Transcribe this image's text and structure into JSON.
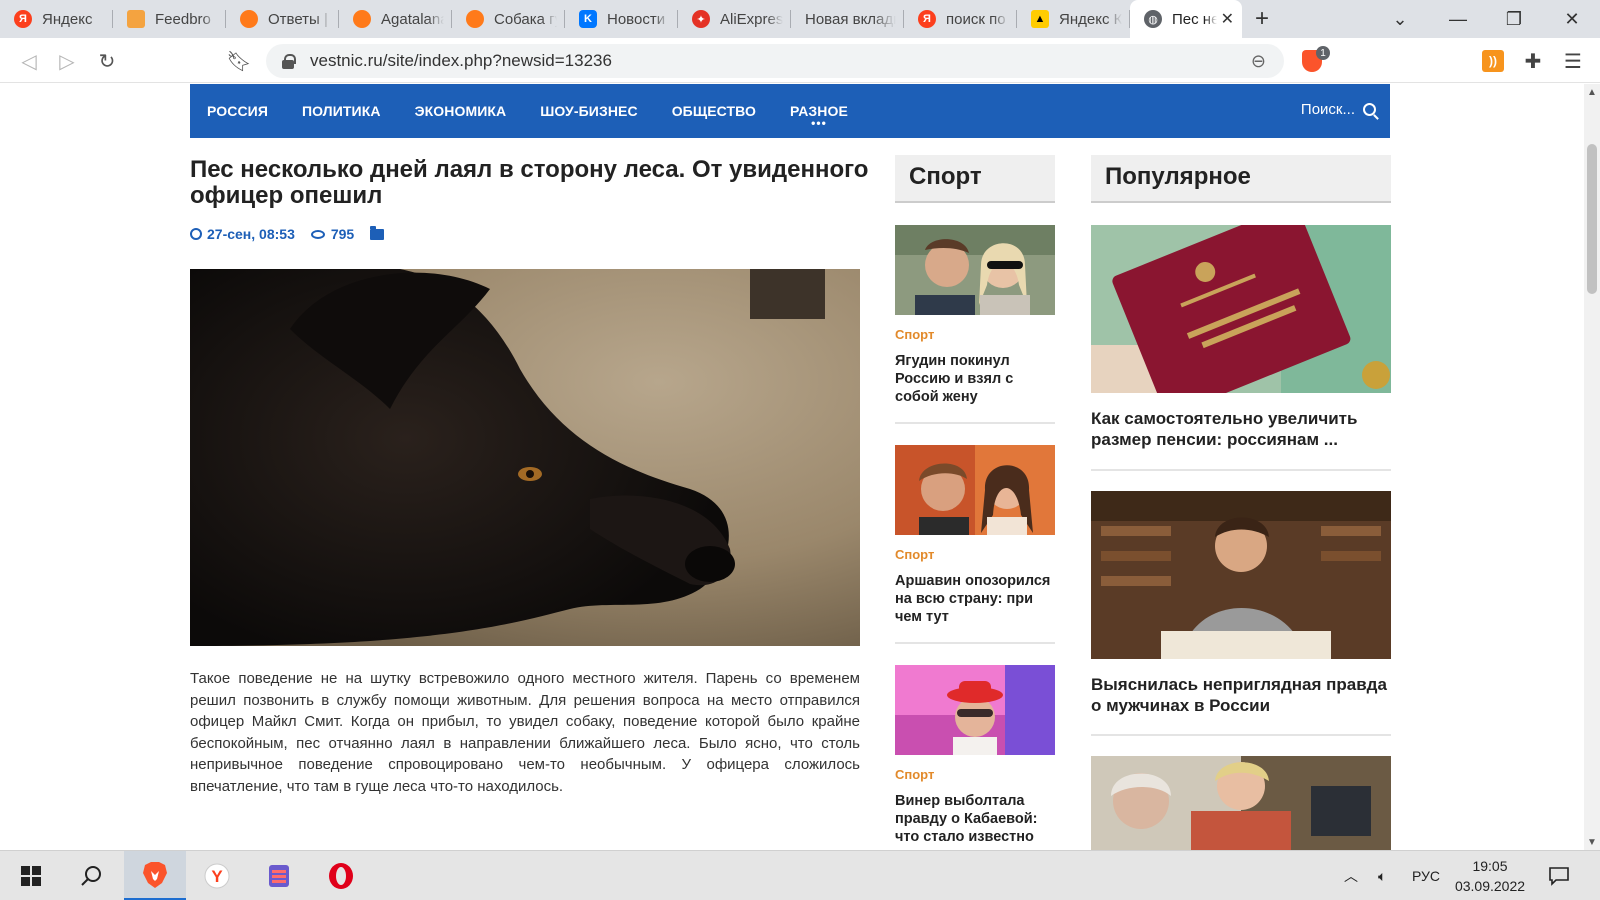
{
  "browser": {
    "tabs": [
      {
        "title": "Яндекс",
        "icon": "yandex-icon"
      },
      {
        "title": "Feedbro",
        "icon": "feedbro-icon"
      },
      {
        "title": "Ответы | Г",
        "icon": "fox-icon"
      },
      {
        "title": "Agatalana",
        "icon": "fox-icon"
      },
      {
        "title": "Собака гу",
        "icon": "fox-icon"
      },
      {
        "title": "Новости",
        "icon": "vk-icon"
      },
      {
        "title": "AliExpress",
        "icon": "aliexpress-icon"
      },
      {
        "title": "Новая вкладк",
        "icon": ""
      },
      {
        "title": "поиск по",
        "icon": "yandex-icon"
      },
      {
        "title": "Яндекс Ка",
        "icon": "yandex-kartinki-icon"
      },
      {
        "title": "Пес не",
        "icon": "globe-icon",
        "active": true
      }
    ],
    "url": "vestnic.ru/site/index.php?newsid=13236",
    "shield_badge": "1"
  },
  "site": {
    "menu": [
      "РОССИЯ",
      "ПОЛИТИКА",
      "ЭКОНОМИКА",
      "ШОУ-БИЗНЕС",
      "ОБЩЕСТВО",
      "РАЗНОЕ"
    ],
    "more_dots": "•••",
    "search_placeholder": "Поиск..."
  },
  "article": {
    "title": "Пес несколько дней лаял в сторону леса. От увиденного офицер опешил",
    "date": "27-сен, 08:53",
    "views": "795",
    "body": "Такое поведение не на шутку встревожило одного местного жителя. Парень со временем решил позвонить в службу помощи животным. Для решения вопроса на место отправился офицер Майкл Смит. Когда он прибыл, то увидел собаку, поведение которой было крайне беспокойным, пес отчаянно лаял в направлении ближайшего леса. Было ясно, что столь непривычное поведение спровоцировано чем-то необычным. У офицера сложилось впечатление, что там в гуще леса что-то находилось."
  },
  "sport": {
    "heading": "Спорт",
    "items": [
      {
        "category": "Спорт",
        "title": "Ягудин покинул Россию и взял с собой жену"
      },
      {
        "category": "Спорт",
        "title": "Аршавин опозорился на всю страну: при чем тут"
      },
      {
        "category": "Спорт",
        "title": "Винер выболтала правду о Кабаевой: что стало известно"
      }
    ]
  },
  "popular": {
    "heading": "Популярное",
    "items": [
      {
        "title": "Как самостоятельно увеличить размер пенсии: россиянам ..."
      },
      {
        "title": "Выяснилась неприглядная правда о мужчинах в России"
      },
      {
        "title": ""
      }
    ]
  },
  "taskbar": {
    "lang": "РУС",
    "time": "19:05",
    "date": "03.09.2022"
  }
}
